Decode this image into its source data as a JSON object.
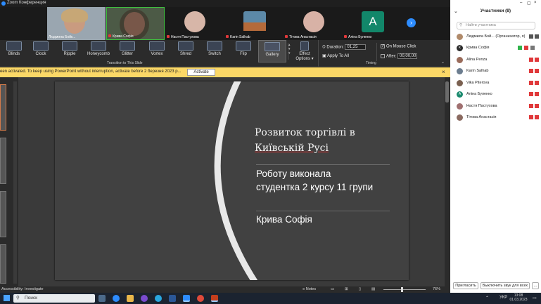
{
  "window": {
    "title": "Zoom Конференция"
  },
  "thumbnails": [
    {
      "name": "Людмила Бойк...",
      "muted": false
    },
    {
      "name": "Крива Софія",
      "muted": true
    },
    {
      "name": "Настя Пастухова",
      "muted": true
    },
    {
      "name": "Karin Salhab",
      "muted": true
    },
    {
      "name": "Тітова Анастасія",
      "muted": true
    },
    {
      "name": "Аліна Буленко",
      "muted": true,
      "initial": "А"
    }
  ],
  "ribbon": {
    "effects": [
      "Blinds",
      "Clock",
      "Ripple",
      "Honeycomb",
      "Glitter",
      "Vortex",
      "Shred",
      "Switch",
      "Flip",
      "Gallery"
    ],
    "selected": "Gallery",
    "effect_options": "Effect Options",
    "group_transition": "Transition to This Slide",
    "duration_label": "Duration:",
    "duration_value": "01,25",
    "apply_all": "Apply To All",
    "on_mouse_click": "On Mouse Click",
    "after_label": "After:",
    "after_value": "00,00,00",
    "group_timing": "Timing"
  },
  "activation": {
    "message": "een activated. To keep using PowerPoint without interruption, activate before 2 березня 2023 р...",
    "button": "Activate"
  },
  "slide": {
    "title_line1": "Розвиток торгівлі в",
    "title_line2": "Київській Русі",
    "sub_line1": "Роботу виконала",
    "sub_line2": "студентка 2 курсу 11 групи",
    "author": "Крива Софія"
  },
  "statusbar": {
    "accessibility": "Accessibility: Investigate",
    "notes": "Notes",
    "zoom": "76%"
  },
  "taskbar": {
    "search_placeholder": "Поиск",
    "lang": "УКР",
    "time": "13:08",
    "date": "01.03.2023"
  },
  "participants": {
    "header": "Участники (8)",
    "search_placeholder": "Найти участника",
    "list": [
      {
        "name": "Людмила Бой... (Организатор, я)",
        "color": "#b08a6a"
      },
      {
        "name": "Крива Софія",
        "color": "#2b2b2b",
        "initial": "К"
      },
      {
        "name": "Alina Penza",
        "color": "#9a6b5a"
      },
      {
        "name": "Karin Salhab",
        "color": "#6c7d8f"
      },
      {
        "name": "Vika Piterova",
        "color": "#7a6050"
      },
      {
        "name": "Аліна Буленко",
        "color": "#1a8a6e",
        "initial": "А"
      },
      {
        "name": "Настя Пастухова",
        "color": "#a07070"
      },
      {
        "name": "Тітова Анастасія",
        "color": "#8a6a60"
      }
    ],
    "invite_button": "Пригласить",
    "mute_all_button": "Выключить звук для всех"
  },
  "colors": {
    "accent": "#2d8cff",
    "muted": "#e0383a",
    "activation_bg": "#fbd867"
  }
}
